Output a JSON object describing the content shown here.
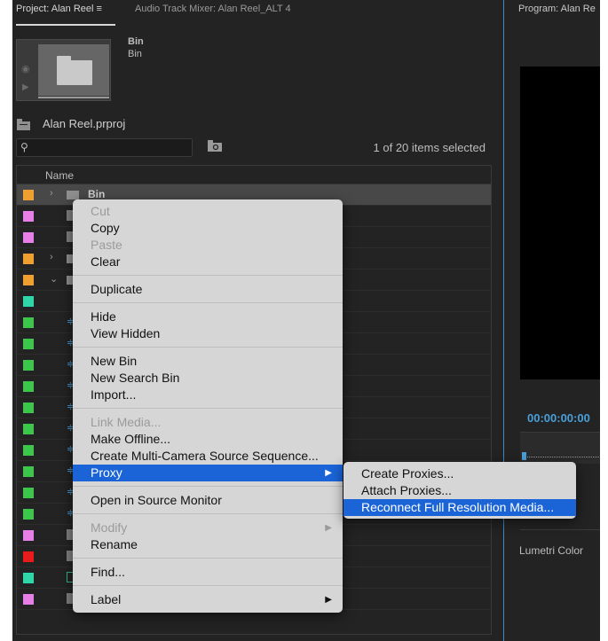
{
  "tabs": {
    "project": "Project: Alan Reel  ≡",
    "mixer": "Audio Track Mixer: Alan Reel_ALT 4",
    "program": "Program: Alan Re"
  },
  "preview": {
    "name": "Bin",
    "type": "Bin"
  },
  "project": {
    "name": "Alan Reel.prproj",
    "items_selected": "1 of 20 items selected"
  },
  "search": {
    "value": "",
    "placeholder": ""
  },
  "list": {
    "column_name": "Name",
    "rows": [
      {
        "color": "#f0a030",
        "twirl": "›",
        "icon": "folder",
        "label": "Bin",
        "selected": true
      },
      {
        "color": "#e680e6",
        "twirl": "",
        "icon": "clip",
        "label": ""
      },
      {
        "color": "#e680e6",
        "twirl": "",
        "icon": "clip",
        "label": ""
      },
      {
        "color": "#f0a030",
        "twirl": "›",
        "icon": "folder",
        "label": ""
      },
      {
        "color": "#f0a030",
        "twirl": "⌄",
        "icon": "folder",
        "label": ""
      },
      {
        "color": "#2fd6a8",
        "twirl": "",
        "icon": "none",
        "label": ""
      },
      {
        "color": "#3ec64c",
        "twirl": "",
        "icon": "audio",
        "label": ""
      },
      {
        "color": "#3ec64c",
        "twirl": "",
        "icon": "audio",
        "label": ""
      },
      {
        "color": "#3ec64c",
        "twirl": "",
        "icon": "audio",
        "label": ""
      },
      {
        "color": "#3ec64c",
        "twirl": "",
        "icon": "audio",
        "label": ""
      },
      {
        "color": "#3ec64c",
        "twirl": "",
        "icon": "audio",
        "label": ""
      },
      {
        "color": "#3ec64c",
        "twirl": "",
        "icon": "audio",
        "label": ""
      },
      {
        "color": "#3ec64c",
        "twirl": "",
        "icon": "audio",
        "label": ""
      },
      {
        "color": "#3ec64c",
        "twirl": "",
        "icon": "audio",
        "label": ""
      },
      {
        "color": "#3ec64c",
        "twirl": "",
        "icon": "audio",
        "label": ""
      },
      {
        "color": "#3ec64c",
        "twirl": "",
        "icon": "audio",
        "label": ""
      },
      {
        "color": "#e680e6",
        "twirl": "",
        "icon": "clip",
        "label": ""
      },
      {
        "color": "#e81c1c",
        "twirl": "",
        "icon": "clip",
        "label": ""
      },
      {
        "color": "#2fd6a8",
        "twirl": "",
        "icon": "seq",
        "label": ""
      },
      {
        "color": "#e680e6",
        "twirl": "",
        "icon": "clip",
        "label": ""
      }
    ]
  },
  "context_menu": {
    "items": [
      {
        "label": "Cut",
        "disabled": true
      },
      {
        "label": "Copy"
      },
      {
        "label": "Paste",
        "disabled": true
      },
      {
        "label": "Clear"
      },
      {
        "separator": true
      },
      {
        "label": "Duplicate"
      },
      {
        "separator": true
      },
      {
        "label": "Hide"
      },
      {
        "label": "View Hidden"
      },
      {
        "separator": true
      },
      {
        "label": "New Bin"
      },
      {
        "label": "New Search Bin"
      },
      {
        "label": "Import..."
      },
      {
        "separator": true
      },
      {
        "label": "Link Media...",
        "disabled": true
      },
      {
        "label": "Make Offline..."
      },
      {
        "label": "Create Multi-Camera Source Sequence..."
      },
      {
        "label": "Proxy",
        "submenu": true,
        "highlighted": true
      },
      {
        "separator": true
      },
      {
        "label": "Open in Source Monitor"
      },
      {
        "separator": true
      },
      {
        "label": "Modify",
        "disabled": true,
        "submenu": true
      },
      {
        "label": "Rename"
      },
      {
        "separator": true
      },
      {
        "label": "Find..."
      },
      {
        "separator": true
      },
      {
        "label": "Label",
        "submenu": true
      }
    ]
  },
  "proxy_submenu": {
    "items": [
      {
        "label": "Create Proxies..."
      },
      {
        "label": "Attach Proxies..."
      },
      {
        "label": "Reconnect Full Resolution Media...",
        "highlighted": true
      }
    ]
  },
  "monitor": {
    "timecode": "00:00:00:00",
    "lumetri": "Lumetri Color"
  }
}
